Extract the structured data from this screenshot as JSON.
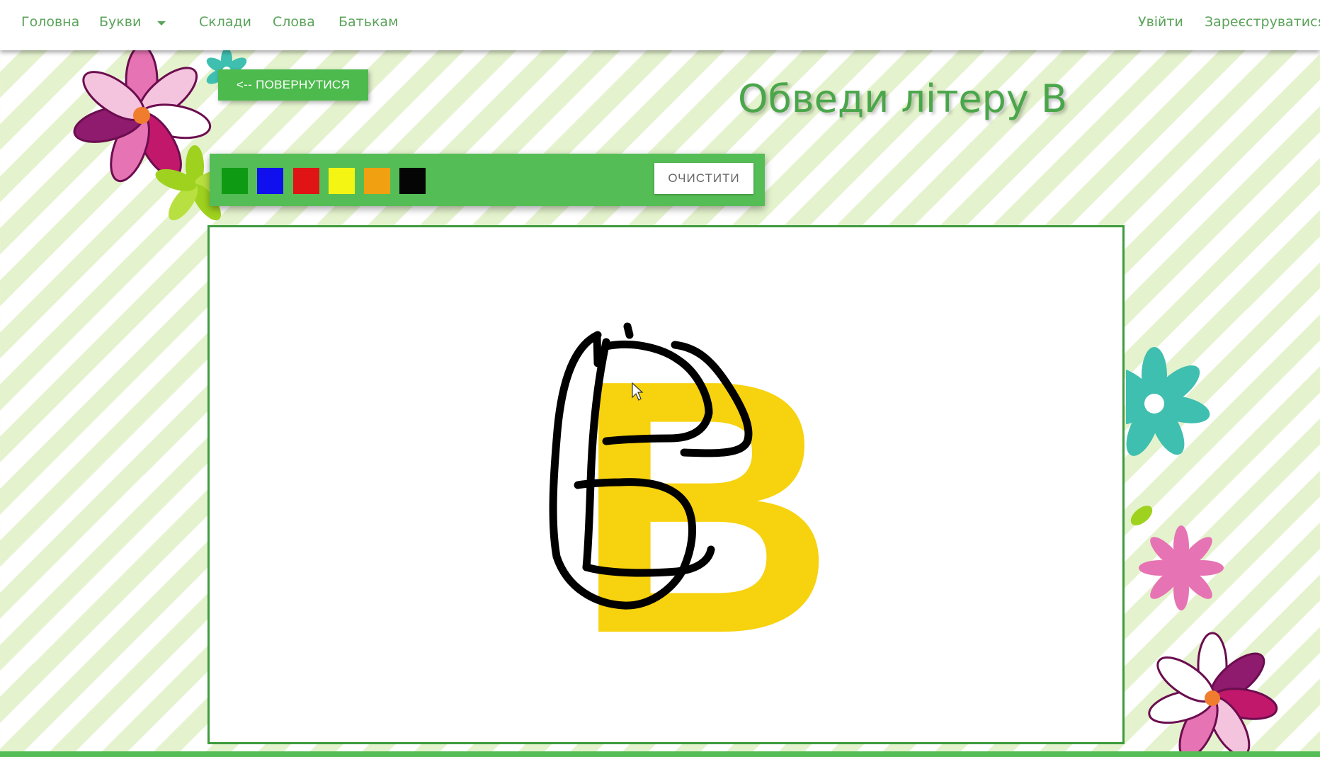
{
  "nav": {
    "home": "Головна",
    "letters": "Букви",
    "syllables": "Склади",
    "words": "Слова",
    "parents": "Батькам",
    "login": "Увійти",
    "register": "Зареєструватися"
  },
  "back_button": "<-- ПОВЕРНУТИСЯ",
  "title": "Обведи літеру В",
  "toolbar": {
    "colors": [
      "#0f9a14",
      "#1010ee",
      "#e01414",
      "#f5f514",
      "#f0a010",
      "#050505"
    ],
    "clear_label": "ОЧИСТИТИ"
  },
  "canvas": {
    "letter": "B",
    "letter_color": "#f7d20e",
    "stroke_color": "#000000"
  }
}
